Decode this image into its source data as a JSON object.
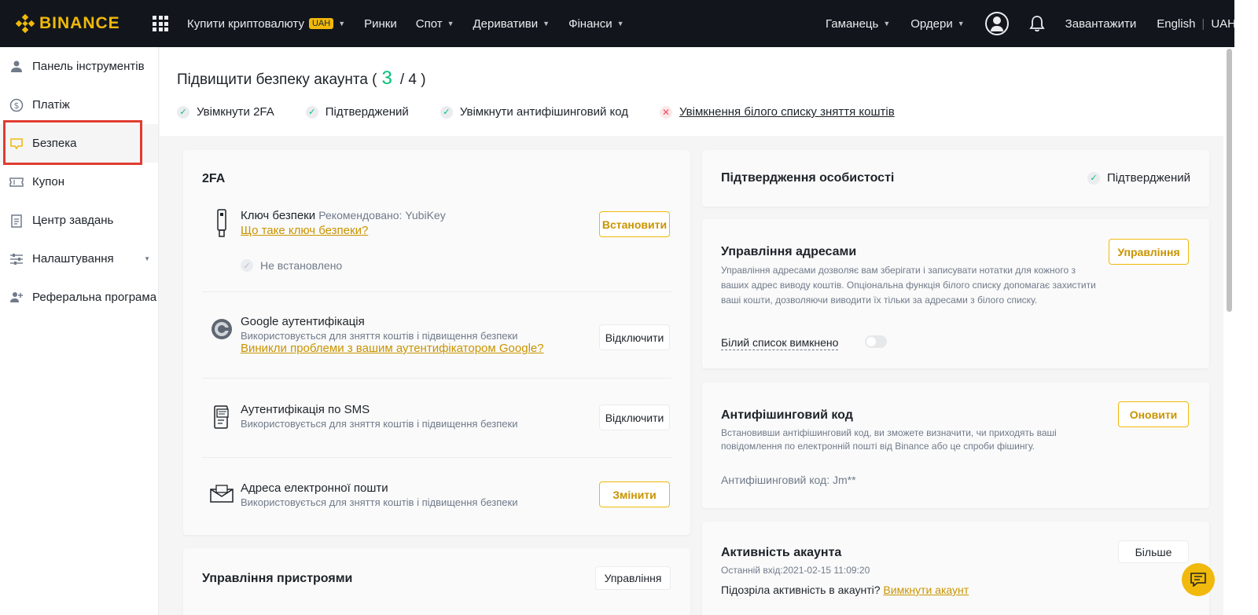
{
  "nav": {
    "logo": "BINANCE",
    "buy_crypto": "Купити криптовалюту",
    "buy_badge": "UAH",
    "markets": "Ринки",
    "spot": "Спот",
    "derivatives": "Деривативи",
    "finance": "Фінанси",
    "wallet": "Гаманець",
    "orders": "Ордери",
    "download": "Завантажити",
    "language": "English",
    "currency": "UAH"
  },
  "sidebar": {
    "items": [
      {
        "label": "Панель інструментів"
      },
      {
        "label": "Платіж"
      },
      {
        "label": "Безпека"
      },
      {
        "label": "Купон"
      },
      {
        "label": "Центр завдань"
      },
      {
        "label": "Налаштування"
      },
      {
        "label": "Реферальна програма"
      }
    ]
  },
  "header": {
    "title": "Підвищити безпеку акаунта (",
    "current": "3",
    "total": "/ 4 )",
    "checks": [
      {
        "label": "Увімкнути 2FA",
        "done": true
      },
      {
        "label": "Підтверджений",
        "done": true
      },
      {
        "label": "Увімкнути антифішинговий код",
        "done": true
      },
      {
        "label": "Увімкнення білого списку зняття коштів",
        "done": false
      }
    ]
  },
  "twofa": {
    "title": "2FA",
    "security_key": {
      "title": "Ключ безпеки",
      "recommend": "Рекомендовано: YubiKey",
      "link": "Що таке ключ безпеки?",
      "status": "Не встановлено",
      "button": "Встановити"
    },
    "google": {
      "title": "Google аутентифікація",
      "sub": "Використовується для зняття коштів і підвищення безпеки",
      "link": "Виникли проблеми з вашим аутентифікатором Google?",
      "button": "Відключити"
    },
    "sms": {
      "title": "Аутентифікація по SMS",
      "sub": "Використовується для зняття коштів і підвищення безпеки",
      "button": "Відключити"
    },
    "email": {
      "title": "Адреса електронної пошти",
      "sub": "Використовується для зняття коштів і підвищення безпеки",
      "button": "Змінити"
    }
  },
  "devices": {
    "title": "Управління пристроями",
    "button": "Управління"
  },
  "identity": {
    "title": "Підтвердження особистості",
    "status": "Підтверджений"
  },
  "address": {
    "title": "Управління адресами",
    "desc": "Управління адресами дозволяє вам зберігати і записувати нотатки для кожного з ваших адрес виводу коштів. Опціональна функція білого списку допомагає захистити ваші кошти, дозволяючи виводити їх тільки за адресами з білого списку.",
    "whitelist": "Білий список вимкнено",
    "button": "Управління"
  },
  "antiphishing": {
    "title": "Антифішинговий код",
    "desc": "Встановивши антіфішинговий код, ви зможете визначити, чи приходять ваші повідомлення по електронній пошті від Binance або це спроби фішингу.",
    "code": "Антифішинговий код: Jm**",
    "button": "Оновити"
  },
  "activity": {
    "title": "Активність акаунта",
    "last_login": "Останній вхід:2021-02-15 11:09:20",
    "suspicious": "Підозріла активність в акаунті?",
    "link": "Вимкнути акаунт",
    "button": "Більше"
  },
  "colors": {
    "brand": "#f0b90b",
    "nav_bg": "#12161c",
    "success": "#02c076",
    "error": "#f6465d",
    "highlight": "#e03c31"
  }
}
